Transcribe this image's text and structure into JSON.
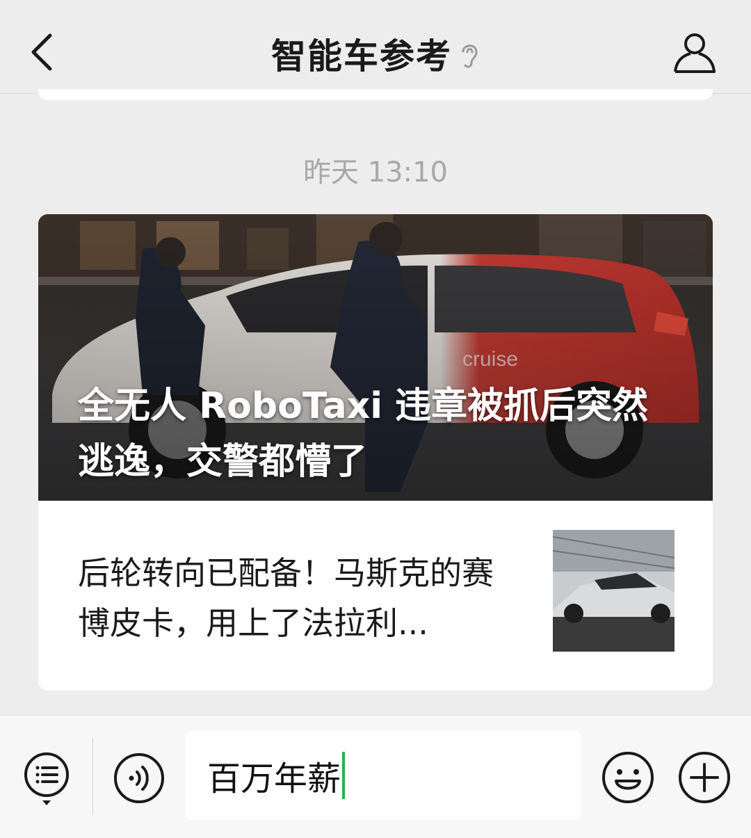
{
  "header": {
    "title": "智能车参考"
  },
  "chat": {
    "timestamp": "昨天 13:10"
  },
  "article_card": {
    "main_title": "全无人 RoboTaxi 违章被抓后突然逃逸，交警都懵了",
    "main_image_text": "cruise",
    "sub_title": "后轮转向已配备！马斯克的赛博皮卡，用上了法拉利..."
  },
  "input_bar": {
    "text_value": "百万年薪"
  },
  "colors": {
    "caret": "#2bb24c",
    "background": "#ededed"
  }
}
